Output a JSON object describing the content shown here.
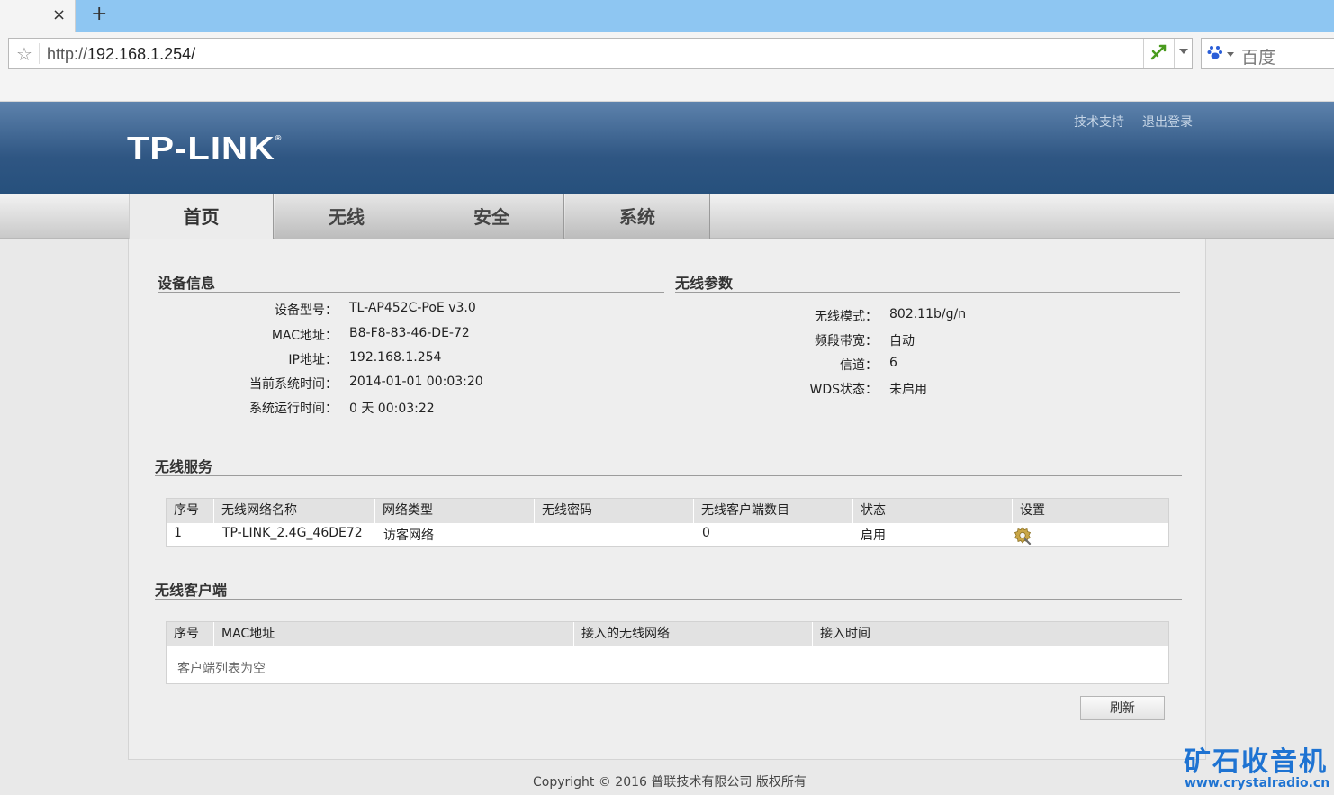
{
  "browser": {
    "close_glyph": "×",
    "newtab_glyph": "+",
    "url_scheme": "http://",
    "url_host": "192.168.1.254/",
    "search_engine": "百度"
  },
  "header": {
    "logo": "TP-LINK",
    "logo_mark": "®",
    "links": [
      "技术支持",
      "退出登录"
    ]
  },
  "nav": {
    "tabs": [
      "首页",
      "无线",
      "安全",
      "系统"
    ],
    "active": "首页"
  },
  "device_info": {
    "title": "设备信息",
    "rows": [
      {
        "label": "设备型号：",
        "value": "TL-AP452C-PoE v3.0"
      },
      {
        "label": "MAC地址：",
        "value": "B8-F8-83-46-DE-72"
      },
      {
        "label": "IP地址：",
        "value": "192.168.1.254"
      },
      {
        "label": "当前系统时间：",
        "value": "2014-01-01 00:03:20"
      },
      {
        "label": "系统运行时间：",
        "value": "0 天 00:03:22"
      }
    ]
  },
  "wireless_params": {
    "title": "无线参数",
    "rows": [
      {
        "label": "无线模式：",
        "value": "802.11b/g/n"
      },
      {
        "label": "频段带宽：",
        "value": "自动"
      },
      {
        "label": "信道：",
        "value": "6"
      },
      {
        "label": "WDS状态：",
        "value": "未启用"
      }
    ]
  },
  "wireless_service": {
    "title": "无线服务",
    "headers": [
      "序号",
      "无线网络名称",
      "网络类型",
      "无线密码",
      "无线客户端数目",
      "状态",
      "设置"
    ],
    "rows": [
      {
        "index": "1",
        "ssid": "TP-LINK_2.4G_46DE72",
        "type": "访客网络",
        "password": "",
        "clients": "0",
        "status": "启用"
      }
    ]
  },
  "wireless_clients": {
    "title": "无线客户端",
    "headers": [
      "序号",
      "MAC地址",
      "接入的无线网络",
      "接入时间"
    ],
    "empty_text": "客户端列表为空",
    "refresh_button": "刷新"
  },
  "footer": {
    "copyright": "Copyright © 2016 普联技术有限公司 版权所有"
  },
  "watermark": {
    "name": "矿石收音机",
    "url": "www.crystalradio.cn"
  },
  "colors": {
    "header_blue": "#2f5683",
    "tab_bar": "#8ec6f2",
    "watermark": "#1e73d2"
  }
}
